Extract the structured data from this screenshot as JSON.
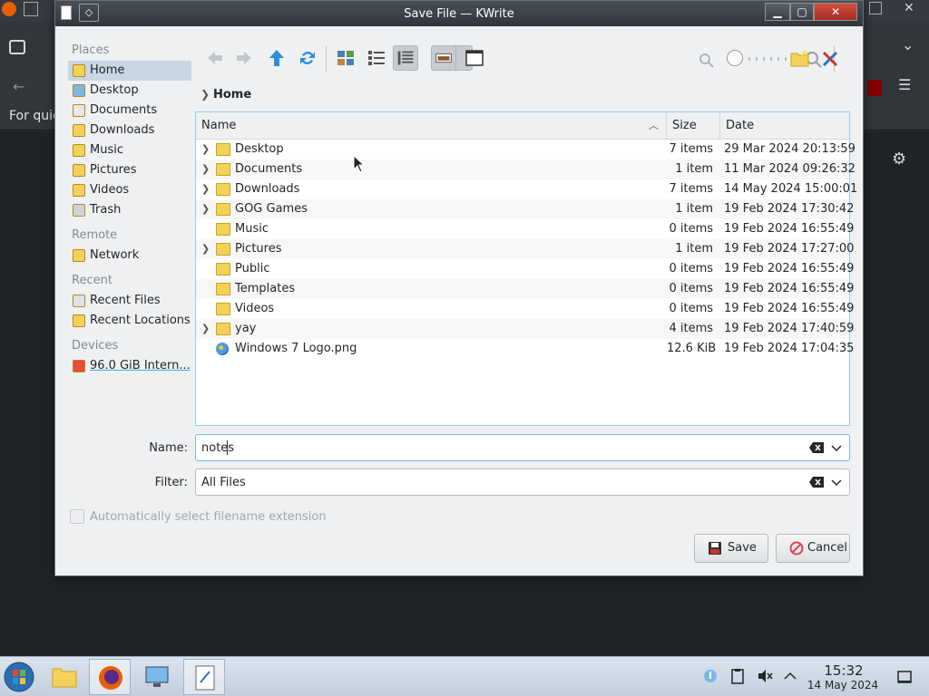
{
  "background_app": {
    "partial_text": "For quic"
  },
  "dialog": {
    "title": "Save File — KWrite"
  },
  "places": {
    "sections": [
      {
        "heading": "Places",
        "items": [
          {
            "label": "Home",
            "icon": "home-icon",
            "selected": true
          },
          {
            "label": "Desktop",
            "icon": "desktop-icon"
          },
          {
            "label": "Documents",
            "icon": "documents-icon"
          },
          {
            "label": "Downloads",
            "icon": "downloads-icon"
          },
          {
            "label": "Music",
            "icon": "music-icon"
          },
          {
            "label": "Pictures",
            "icon": "pictures-icon"
          },
          {
            "label": "Videos",
            "icon": "videos-icon"
          },
          {
            "label": "Trash",
            "icon": "trash-icon"
          }
        ]
      },
      {
        "heading": "Remote",
        "items": [
          {
            "label": "Network",
            "icon": "network-icon"
          }
        ]
      },
      {
        "heading": "Recent",
        "items": [
          {
            "label": "Recent Files",
            "icon": "recent-files-icon"
          },
          {
            "label": "Recent Locations",
            "icon": "recent-locations-icon"
          }
        ]
      },
      {
        "heading": "Devices",
        "items": [
          {
            "label": "96.0 GiB Intern...",
            "icon": "drive-icon"
          }
        ]
      }
    ]
  },
  "breadcrumb": {
    "current": "Home"
  },
  "file_view": {
    "columns": {
      "name": "Name",
      "size": "Size",
      "date": "Date"
    },
    "rows": [
      {
        "name": "Desktop",
        "size": "7 items",
        "date": "29 Mar 2024 20:13:59",
        "expandable": true,
        "icon": "desktop-folder-icon"
      },
      {
        "name": "Documents",
        "size": "1 item",
        "date": "11 Mar 2024 09:26:32",
        "expandable": true,
        "icon": "documents-folder-icon"
      },
      {
        "name": "Downloads",
        "size": "7 items",
        "date": "14 May 2024 15:00:01",
        "expandable": true,
        "icon": "downloads-folder-icon"
      },
      {
        "name": "GOG Games",
        "size": "1 item",
        "date": "19 Feb 2024 17:30:42",
        "expandable": true,
        "icon": "folder-icon"
      },
      {
        "name": "Music",
        "size": "0 items",
        "date": "19 Feb 2024 16:55:49",
        "expandable": false,
        "icon": "music-folder-icon"
      },
      {
        "name": "Pictures",
        "size": "1 item",
        "date": "19 Feb 2024 17:27:00",
        "expandable": true,
        "icon": "pictures-folder-icon"
      },
      {
        "name": "Public",
        "size": "0 items",
        "date": "19 Feb 2024 16:55:49",
        "expandable": false,
        "icon": "public-folder-icon"
      },
      {
        "name": "Templates",
        "size": "0 items",
        "date": "19 Feb 2024 16:55:49",
        "expandable": false,
        "icon": "templates-folder-icon"
      },
      {
        "name": "Videos",
        "size": "0 items",
        "date": "19 Feb 2024 16:55:49",
        "expandable": false,
        "icon": "videos-folder-icon"
      },
      {
        "name": "yay",
        "size": "4 items",
        "date": "19 Feb 2024 17:40:59",
        "expandable": true,
        "icon": "folder-icon"
      },
      {
        "name": "Windows 7 Logo.png",
        "size": "12.6 KiB",
        "date": "19 Feb 2024 17:04:35",
        "expandable": false,
        "icon": "image-file-icon"
      }
    ]
  },
  "form": {
    "name_label": "Name:",
    "name_value": "notes",
    "filter_label": "Filter:",
    "filter_value": "All Files",
    "auto_ext_label": "Automatically select filename extension",
    "auto_ext_checked": false
  },
  "buttons": {
    "save": "Save",
    "cancel": "Cancel"
  },
  "taskbar": {
    "time": "15:32",
    "date": "14 May 2024"
  },
  "colors": {
    "accent": "#3daee9",
    "selection": "#c9d7e4",
    "folder": "#f4c430"
  }
}
